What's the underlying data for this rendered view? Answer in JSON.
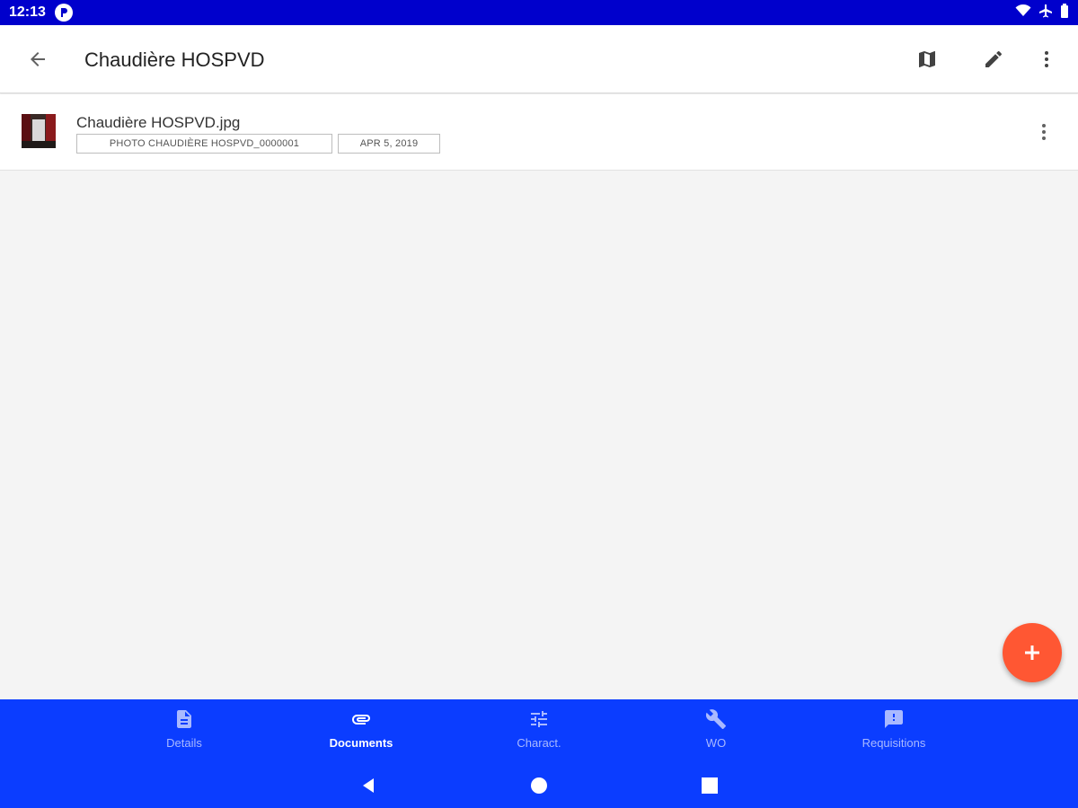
{
  "status_bar": {
    "time": "12:13"
  },
  "app_bar": {
    "title": "Chaudière HOSPVD"
  },
  "documents": [
    {
      "name": "Chaudière HOSPVD.jpg",
      "reference": "PHOTO CHAUDIÈRE HOSPVD_0000001",
      "date": "APR 5, 2019"
    }
  ],
  "bottom_nav": {
    "items": [
      {
        "label": "Details",
        "icon": "document-icon"
      },
      {
        "label": "Documents",
        "icon": "attachment-icon",
        "active": true
      },
      {
        "label": "Charact.",
        "icon": "tune-icon"
      },
      {
        "label": "WO",
        "icon": "wrench-icon"
      },
      {
        "label": "Requisitions",
        "icon": "feedback-icon"
      }
    ]
  },
  "colors": {
    "status_bar": "#0000cc",
    "nav_background": "#0b3dff",
    "fab": "#ff5733",
    "nav_inactive": "#a9b9ff"
  }
}
